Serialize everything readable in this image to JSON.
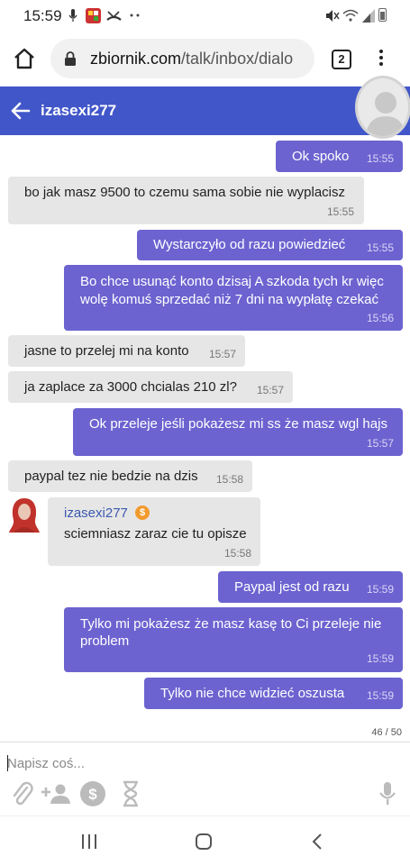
{
  "status_bar": {
    "time": "15:59"
  },
  "browser": {
    "url_host": "zbiornik.com",
    "url_path": "/talk/inbox/dialo",
    "tab_count": "2"
  },
  "chat": {
    "contact_name": "izasexi277",
    "messages": [
      {
        "dir": "out",
        "text": "Ok spoko",
        "time": "15:55"
      },
      {
        "dir": "in",
        "text": "bo jak masz 9500 to czemu sama sobie nie wyplacisz",
        "time": "15:55"
      },
      {
        "dir": "out",
        "text": "Wystarczyło od razu powiedzieć",
        "time": "15:55"
      },
      {
        "dir": "out",
        "text_lines": [
          "Bo chce usunąć konto dzisaj A szkoda tych kr więc",
          "wolę komuś sprzedać niż 7 dni na wypłatę czekać"
        ],
        "time": "15:56"
      },
      {
        "dir": "in",
        "text": "jasne to przelej mi na konto",
        "time": "15:57"
      },
      {
        "dir": "in",
        "text": "ja zaplace za 3000 chcialas 210 zl?",
        "time": "15:57"
      },
      {
        "dir": "out",
        "text": "Ok przeleje jeśli pokażesz mi ss że masz wgl hajs",
        "time": "15:57"
      },
      {
        "dir": "in",
        "text": "paypal tez nie bedzie na dzis",
        "time": "15:58"
      },
      {
        "dir": "in",
        "sender": "izasexi277",
        "text": "sciemniasz zaraz cie tu opisze",
        "time": "15:58"
      },
      {
        "dir": "out",
        "text": "Paypal jest od razu",
        "time": "15:59"
      },
      {
        "dir": "out",
        "text_lines": [
          "Tylko mi pokażesz że masz kasę to Ci przeleje nie",
          "problem"
        ],
        "time": "15:59"
      },
      {
        "dir": "out",
        "text": "Tylko nie chce widzieć oszusta",
        "time": "15:59"
      }
    ],
    "counter": "46 / 50",
    "input_placeholder": "Napisz coś..."
  },
  "icons": {
    "status": [
      "mic-icon",
      "app-icon",
      "missed-call-icon",
      "more-dots-icon",
      "mute-icon",
      "wifi-icon",
      "signal-icon",
      "battery-icon"
    ],
    "toolbar": [
      "attach-icon",
      "add-person-icon",
      "dollar-icon",
      "hourglass-icon",
      "mic-icon"
    ],
    "nav": [
      "recent-apps-icon",
      "home-icon",
      "back-icon"
    ]
  },
  "colors": {
    "header": "#4156c9",
    "outgoing_bubble": "#6c63d0",
    "incoming_bubble": "#e6e6e6",
    "sender_name": "#3c59b0",
    "coin": "#f29a2e"
  }
}
